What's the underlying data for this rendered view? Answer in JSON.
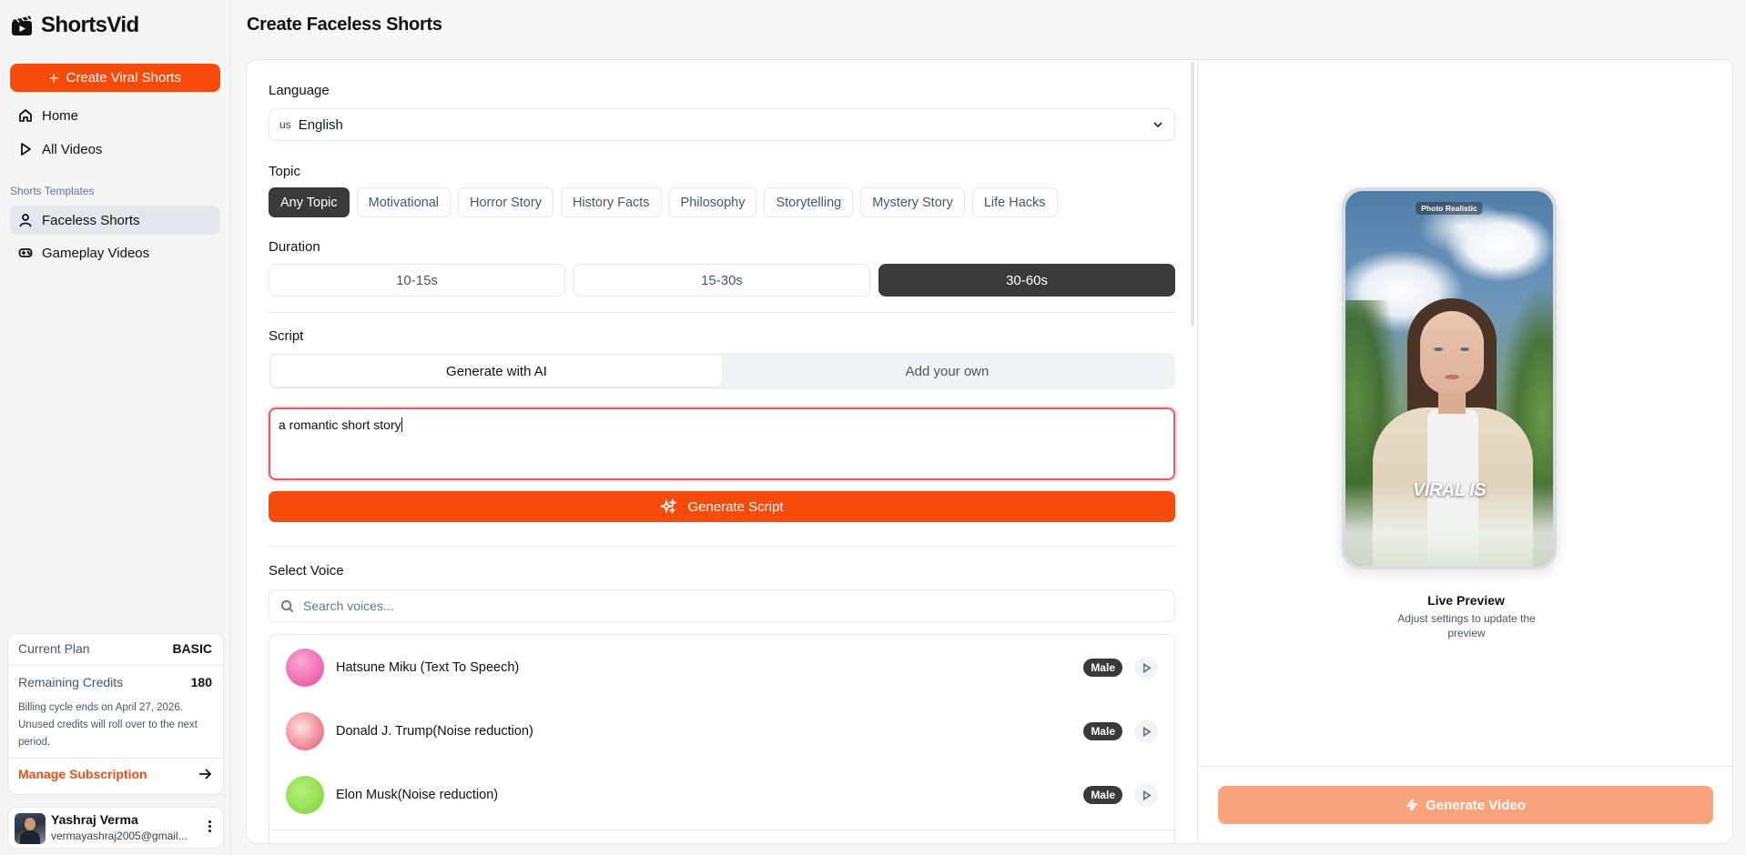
{
  "brand": {
    "name": "ShortsVid"
  },
  "sidebar": {
    "create_label": "Create Viral Shorts",
    "nav": [
      {
        "label": "Home",
        "icon": "home-icon"
      },
      {
        "label": "All Videos",
        "icon": "play-icon"
      }
    ],
    "templates_label": "Shorts Templates",
    "templates": [
      {
        "label": "Faceless Shorts",
        "icon": "user-icon",
        "active": true
      },
      {
        "label": "Gameplay Videos",
        "icon": "gamepad-icon",
        "active": false
      }
    ],
    "plan": {
      "plan_label": "Current Plan",
      "plan_value": "BASIC",
      "credits_label": "Remaining Credits",
      "credits_value": "180",
      "note": "Billing cycle ends on April 27, 2026. Unused credits will roll over to the next period.",
      "manage_label": "Manage Subscription"
    },
    "user": {
      "name": "Yashraj Verma",
      "email": "vermayashraj2005@gmail..."
    }
  },
  "page": {
    "title": "Create Faceless Shorts"
  },
  "form": {
    "language": {
      "label": "Language",
      "flag": "us",
      "value": "English"
    },
    "topic": {
      "label": "Topic",
      "options": [
        "Any Topic",
        "Motivational",
        "Horror Story",
        "History Facts",
        "Philosophy",
        "Storytelling",
        "Mystery Story",
        "Life Hacks"
      ],
      "selected": "Any Topic"
    },
    "duration": {
      "label": "Duration",
      "options": [
        "10-15s",
        "15-30s",
        "30-60s"
      ],
      "selected": "30-60s"
    },
    "script": {
      "label": "Script",
      "tabs": [
        "Generate with AI",
        "Add your own"
      ],
      "active_tab": "Generate with AI",
      "prompt_value": "a romantic short story",
      "generate_label": "Generate Script"
    },
    "voice": {
      "label": "Select Voice",
      "search_placeholder": "Search voices...",
      "voices": [
        {
          "name": "Hatsune Miku (Text To Speech)",
          "gender": "Male",
          "color": "#f06fb0"
        },
        {
          "name": "Donald J. Trump(Noise reduction)",
          "gender": "Male",
          "color": "#f08a9c"
        },
        {
          "name": "Elon Musk(Noise reduction)",
          "gender": "Male",
          "color": "#8fd94a"
        }
      ]
    }
  },
  "preview": {
    "style_badge": "Photo Realistic",
    "overlay_text": "VIRAL IS",
    "title": "Live Preview",
    "subtitle": "Adjust settings to update the preview",
    "generate_label": "Generate Video"
  },
  "colors": {
    "accent": "#f74b0c",
    "accent_disabled": "#f9a47c",
    "dark": "#3a3a3a"
  }
}
